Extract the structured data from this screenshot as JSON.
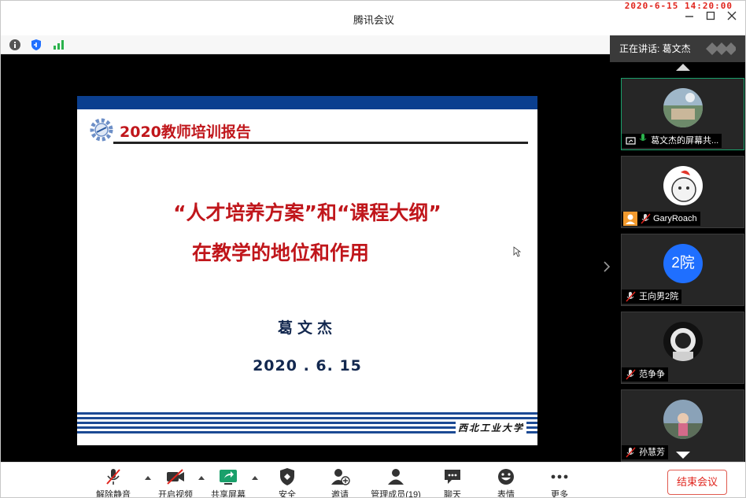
{
  "window": {
    "title": "腾讯会议",
    "timestamp": "2020-6-15  14:20:00"
  },
  "slide": {
    "header": "2020教师培训报告",
    "line1": "“人才培养方案”和“课程大纲”",
    "line2": "在教学的地位和作用",
    "author": "葛文杰",
    "date": "2020 . 6. 15",
    "school_logo_text": "西北工业大学"
  },
  "sidebar": {
    "speaking_label": "正在讲话: 葛文杰",
    "participants": [
      {
        "name": "葛文杰的屏幕共...",
        "avatar_initials": ""
      },
      {
        "name": "GaryRoach",
        "avatar_initials": ""
      },
      {
        "name": "王向男2院",
        "avatar_initials": "2院"
      },
      {
        "name": "范争争",
        "avatar_initials": ""
      },
      {
        "name": "孙慧芳",
        "avatar_initials": ""
      }
    ]
  },
  "toolbar": {
    "unmute": "解除静音",
    "start_video": "开启视频",
    "share_screen": "共享屏幕",
    "security": "安全",
    "invite": "邀请",
    "manage_members": "管理成员(19)",
    "chat": "聊天",
    "reactions": "表情",
    "more": "更多",
    "end_meeting": "结束会议"
  },
  "colors": {
    "end_button": "#e0241c",
    "slide_title": "#c0161b",
    "slide_bar": "#0b3f8f",
    "avatar_blue": "#1f6fff"
  }
}
